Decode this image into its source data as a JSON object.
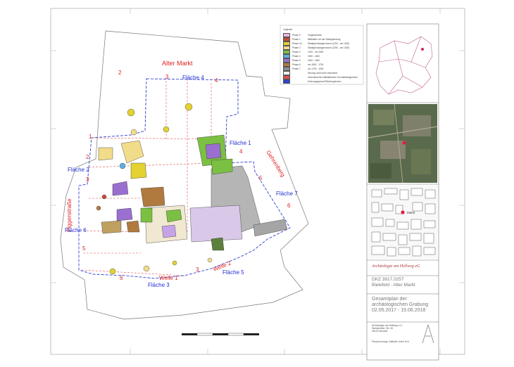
{
  "labels": {
    "alter_markt": "Alter Markt",
    "gehrenberg": "Gehrenberg",
    "piggenstrasse": "Piggenstraße",
    "flaeche1": "Fläche 1",
    "flaeche2": "Fläche 2",
    "flaeche3": "Fläche 3",
    "flaeche4": "Fläche 4",
    "flaeche5": "Fläche 5",
    "flaeche6": "Fläche 6",
    "flaeche7": "Fläche 7",
    "welle1": "Welle 1",
    "welle2": "Welle 2"
  },
  "numbers": [
    "1",
    "2",
    "2",
    "3",
    "4",
    "4",
    "5",
    "6",
    "3",
    "5",
    "6",
    "3"
  ],
  "legend": {
    "title": "Legende",
    "items": [
      {
        "code": "Phase 0",
        "text": "Vorgeschichte",
        "color": "#e9b8d8"
      },
      {
        "code": "Phase 1",
        "text": "Mittelalter vor der Stadtgründung",
        "color": "#c84a3a"
      },
      {
        "code": "Phase 2a",
        "text": "Stadtgründungshorizont (1200 - um 1300)",
        "color": "#e3d231"
      },
      {
        "code": "Phase 2",
        "text": "Stadtgründungshorizont (1200 - um 1300)",
        "color": "#f1dc8a"
      },
      {
        "code": "Phase 3",
        "text": "1200 - um 1500",
        "color": "#7bc043"
      },
      {
        "code": "Phase 4",
        "text": "1500 - 1600",
        "color": "#5ab0e0"
      },
      {
        "code": "Phase 5",
        "text": "1600 - 1800",
        "color": "#9b6fd0"
      },
      {
        "code": "Phase 6",
        "text": "um 1800 - 1700",
        "color": "#b07a3f"
      },
      {
        "code": "Phase 7",
        "text": "um 1700 - 1900",
        "color": "#8d8d8d"
      },
      {
        "code": "",
        "text": "Störung nicht mehr erkennbar",
        "color": "#ffffff"
      },
      {
        "code": "",
        "text": "rekonstruierte mittelalterliche Grundstücksgrenzen",
        "color": "#e05050"
      },
      {
        "code": "",
        "text": "Grabungsgrenze/Flächengrenzen",
        "color": "#3040d0"
      }
    ]
  },
  "panel": {
    "company": "Archäologie am Hellweg eG",
    "dkz": "DKZ 3917,0257",
    "site": "Bielefeld - Alter Markt",
    "title_line1": "Gesamtplan der",
    "title_line2": "archäologischen Grabung",
    "title_line3": "02.05.2017 - 15.06.2018",
    "address_line1": "Archäologie am Hellweg e.G.",
    "address_line2": "Westwerkstr. Str. 84",
    "address_line3": "48143 Münster",
    "drawn_by": "Planzeichnung: Nathalie Liebe M.A.",
    "marker_label": "Markt"
  },
  "colors": {
    "phase0": "#e9b8d8",
    "phase1": "#c84a3a",
    "phase2a": "#e3d231",
    "phase2": "#f1dc8a",
    "phase3": "#7bc043",
    "phase4": "#5ab0e0",
    "phase5": "#9b6fd0",
    "phase6": "#b07a3f",
    "phase7": "#8d8d8d",
    "boundary_red": "#e05050",
    "boundary_blue": "#3040d0",
    "label_red": "#e02020",
    "label_blue": "#2030d0"
  }
}
